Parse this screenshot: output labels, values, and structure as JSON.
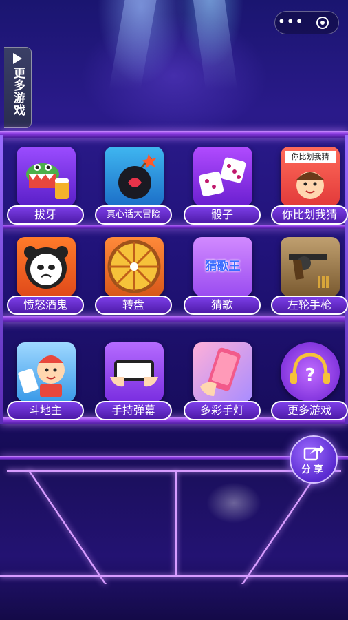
{
  "capsule": {
    "more_icon": "more-dots-icon",
    "close_icon": "target-icon",
    "more_glyph": "•••"
  },
  "side_tab": {
    "label": "更多游戏"
  },
  "games": [
    {
      "label": "拔牙",
      "icon": "crocodile-icon"
    },
    {
      "label": "真心话大冒险",
      "icon": "bomb-heart-icon"
    },
    {
      "label": "骰子",
      "icon": "dice-icon"
    },
    {
      "label": "你比划我猜",
      "icon": "charades-icon",
      "icon_text": "你比划我猜"
    },
    {
      "label": "愤怒酒鬼",
      "icon": "panda-icon"
    },
    {
      "label": "转盘",
      "icon": "wheel-icon"
    },
    {
      "label": "猜歌",
      "icon": "guess-song-icon",
      "icon_text": "猜歌王"
    },
    {
      "label": "左轮手枪",
      "icon": "revolver-icon"
    },
    {
      "label": "斗地主",
      "icon": "cards-icon"
    },
    {
      "label": "手持弹幕",
      "icon": "phone-hands-icon"
    },
    {
      "label": "多彩手灯",
      "icon": "phone-light-icon"
    },
    {
      "label": "更多游戏",
      "icon": "question-headphones-icon"
    }
  ],
  "share": {
    "label": "分享",
    "icon": "share-arrow-icon"
  },
  "colors": {
    "accent": "#7d3fe8",
    "shelf": "#c98bff",
    "background": "#160c4a"
  }
}
